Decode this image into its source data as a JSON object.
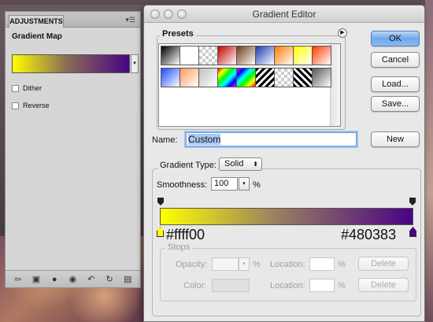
{
  "adjustments": {
    "tab_label": "ADJUSTMENTS",
    "menu_icon": "panel-menu-icon",
    "title": "Gradient Map",
    "gradient": {
      "from": "#ffff00",
      "to": "#480383"
    },
    "dither_label": "Dither",
    "reverse_label": "Reverse",
    "toolbar_icons": [
      "back-arrow-icon",
      "panel-view-icon",
      "clip-layer-icon",
      "visibility-eye-icon",
      "previous-state-icon",
      "reset-icon",
      "trash-icon"
    ]
  },
  "editor": {
    "window_title": "Gradient Editor",
    "presets_label": "Presets",
    "presets": [
      [
        "#000000",
        "#ffffff",
        "checker",
        "#c00000",
        "#6b3b18",
        "#1a3ab0",
        "#ff7a00",
        "#ffff00",
        "#ff3a00"
      ],
      [
        "#1a4aff",
        "#ff9c60",
        "#c0c0c0",
        "rainbow",
        "rainbow2",
        "stripes",
        "checker2",
        "stripes2",
        "#555555"
      ]
    ],
    "buttons": {
      "ok": "OK",
      "cancel": "Cancel",
      "load": "Load...",
      "save": "Save...",
      "new": "New"
    },
    "name_label": "Name:",
    "name_value": "Custom",
    "gradient_type_label": "Gradient Type:",
    "gradient_type_value": "Solid",
    "smoothness_label": "Smoothness:",
    "smoothness_value": "100",
    "percent": "%",
    "gradient_from": "#ffff00",
    "gradient_to": "#480383",
    "stop_left_hex": "#ffff00",
    "stop_right_hex": "#480383",
    "stops": {
      "label": "Stops",
      "opacity_label": "Opacity:",
      "color_label": "Color:",
      "location_label": "Location:",
      "delete_label": "Delete"
    }
  }
}
